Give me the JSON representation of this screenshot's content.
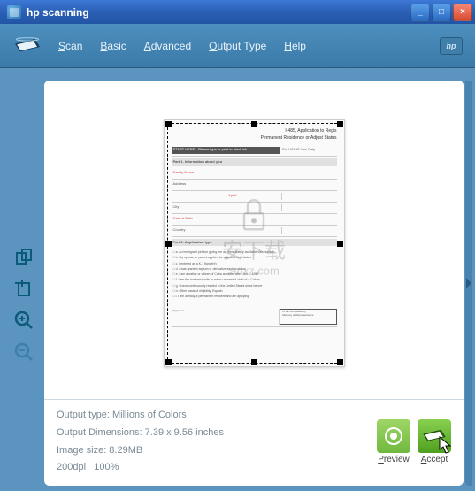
{
  "window": {
    "title": "hp scanning"
  },
  "menu": {
    "scan": "Scan",
    "basic": "Basic",
    "advanced": "Advanced",
    "output_type": "Output Type",
    "help": "Help"
  },
  "hp_logo": "hp",
  "info": {
    "output_type": "Output type: Millions of Colors",
    "dimensions": "Output Dimensions: 7.39 x 9.56 inches",
    "image_size": "Image size: 8.29MB",
    "dpi": "200dpi",
    "zoom": "100%"
  },
  "actions": {
    "preview": "Preview",
    "accept": "Accept"
  },
  "watermark": {
    "main": "安下载",
    "url": "anxz.com"
  },
  "document": {
    "title1": "I-485, Application to Regis",
    "title2": "Permanent Residence or Adjust Status",
    "part1": "Part 1.   Information about you",
    "instruction": "START HERE - Please type or print in black ink",
    "uscis": "For USCIS Use Only",
    "part2": "Part 2.   Application type"
  }
}
